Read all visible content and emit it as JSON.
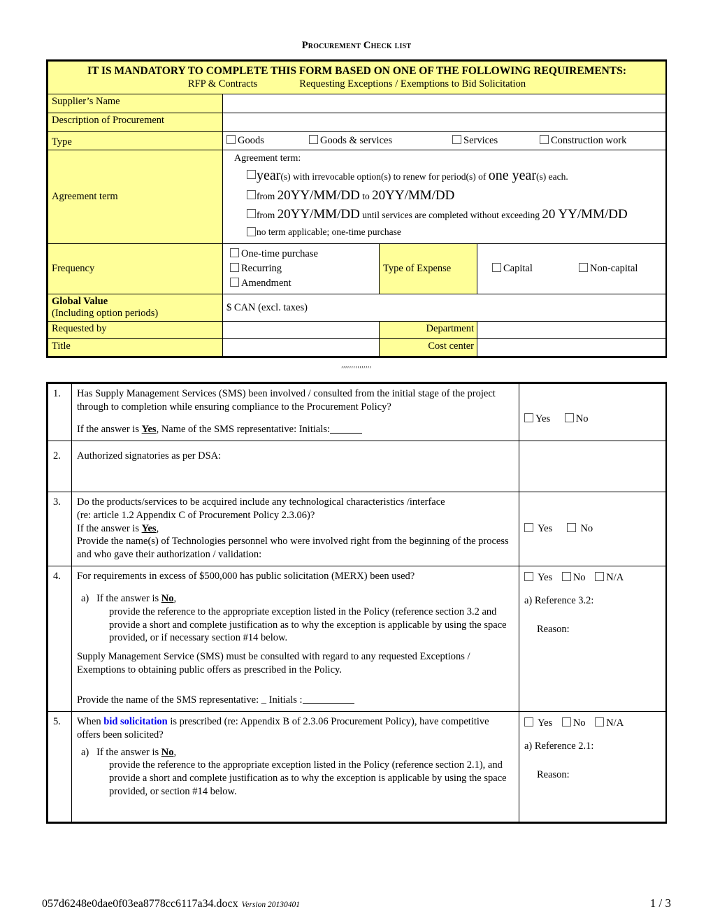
{
  "document": {
    "title": "Procurement Check list"
  },
  "banner": {
    "main": "IT IS MANDATORY TO COMPLETE THIS FORM BASED ON ONE OF THE FOLLOWING REQUIREMENTS:",
    "option1": "RFP & Contracts",
    "option2": "Requesting Exceptions / Exemptions to Bid Solicitation"
  },
  "form": {
    "supplier_name_label": "Supplier’s Name",
    "supplier_name_value": "",
    "description_label": "Description of Procurement",
    "description_value": "",
    "type_label": "Type",
    "type_options": [
      "Goods",
      "Goods & services",
      "Services",
      "Construction work"
    ],
    "agreement_term_label": "Agreement term",
    "agreement_term_heading": "Agreement term:",
    "agreement_term_options": [
      {
        "parts": [
          {
            "text": "year",
            "size": "big"
          },
          {
            "text": "(s) with   irrevocable option(s) to renew for  period(s) of ",
            "size": "small"
          },
          {
            "text": "one year",
            "size": "big"
          },
          {
            "text": "(s) each.",
            "size": "small"
          }
        ]
      },
      {
        "parts": [
          {
            "text": "from ",
            "size": "small"
          },
          {
            "text": "20YY/MM/DD",
            "size": "big2"
          },
          {
            "text": " to ",
            "size": "small"
          },
          {
            "text": "20YY/MM/DD",
            "size": "big2"
          }
        ]
      },
      {
        "parts": [
          {
            "text": "from ",
            "size": "small"
          },
          {
            "text": "20YY/MM/DD",
            "size": "big2"
          },
          {
            "text": " until services are completed without exceeding ",
            "size": "small"
          },
          {
            "text": "20 YY/MM/DD",
            "size": "big2"
          }
        ]
      },
      {
        "parts": [
          {
            "text": "no term applicable; one-time purchase",
            "size": "small"
          }
        ]
      }
    ],
    "frequency_label": "Frequency",
    "frequency_options": [
      "One-time purchase",
      "Recurring",
      "Amendment"
    ],
    "expense_label": "Type of Expense",
    "expense_options": [
      "Capital",
      "Non-capital"
    ],
    "global_value_label": "Global Value",
    "global_value_sub": "(Including option periods)",
    "global_value_text": "$  CAN (excl. taxes)",
    "requested_by_label": "Requested by",
    "requested_by_value": "",
    "department_label": "Department",
    "department_value": "",
    "title_label": "Title",
    "title_value": "",
    "cost_center_label": "Cost center",
    "cost_center_value": ""
  },
  "separator": "′′′′′′′′′′′′′′′",
  "questions": [
    {
      "number": "1.",
      "body_line1": "Has Supply Management Services (SMS) been involved / consulted from the initial stage of the project through to completion while ensuring compliance to the Procurement Policy?",
      "followup_prefix": "If the answer is ",
      "followup_bold": "Yes",
      "followup_rest": ",    Name of the SMS representative:        Initials:",
      "options": [
        "Yes",
        "No"
      ]
    },
    {
      "number": "2.",
      "body_line1": "Authorized signatories as per DSA:",
      "options": []
    },
    {
      "number": "3.",
      "body_line1": "Do the products/services to be acquired include any technological characteristics /interface",
      "body_line2": "(re: article 1.2 Appendix C of Procurement Policy 2.3.06)?",
      "body_line3_prefix": "If the answer is ",
      "body_line3_bold": "Yes",
      "body_line3_rest": ",",
      "body_line4": "Provide the name(s) of Technologies personnel who were involved right from the beginning of the process and who gave their authorization / validation:",
      "options": [
        "Yes",
        "No"
      ]
    },
    {
      "number": "4.",
      "body_line1": "For requirements in excess of $500,000 has public solicitation (MERX) been used?",
      "sub_marker": "a)",
      "sub_prefix": "If the answer is ",
      "sub_bold": "No",
      "sub_rest": ",",
      "sub_body": "provide the reference to the appropriate exception listed in the Policy (reference section 3.2 and provide a short and complete justification as to why the exception is applicable by using the space provided, or if necessary section #14 below.",
      "note": "Supply Management Service (SMS) must be consulted with regard to any requested Exceptions / Exemptions to obtaining public offers as prescribed in the Policy.",
      "rep_line": " Provide the name of the SMS representative: _  Initials :",
      "options": [
        "Yes",
        "No",
        "N/A"
      ],
      "reference_label": "a) Reference 3.2:",
      "reason_label": "Reason:"
    },
    {
      "number": "5.",
      "body_prefix": "When ",
      "body_highlight": "bid solicitation",
      "body_rest": " is prescribed (re: Appendix B of 2.3.06 Procurement Policy), have competitive offers been solicited?",
      "sub_marker": "a)",
      "sub_prefix": "If the answer is ",
      "sub_bold": "No",
      "sub_rest": ",",
      "sub_body": "provide the reference to the appropriate exception listed in the Policy (reference section 2.1), and provide a short and complete justification as to why the exception is applicable by using the space provided, or section #14 below.",
      "options": [
        "Yes",
        "No",
        "N/A"
      ],
      "reference_label": "a) Reference 2.1:",
      "reason_label": "Reason:"
    }
  ],
  "footer": {
    "filename": "057d6248e0dae0f03ea8778cc6117a34.docx",
    "version": "Version 20130401",
    "page": "1 / 3"
  },
  "colors": {
    "highlight_yellow": "#ffff99",
    "link_blue": "#0000ee"
  }
}
